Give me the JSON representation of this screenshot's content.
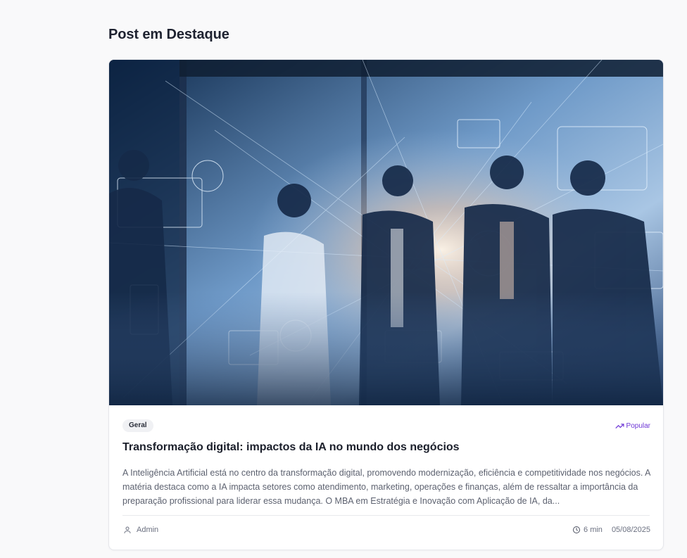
{
  "section": {
    "title": "Post em Destaque"
  },
  "post": {
    "image_alt": "Profissionais de negócios em reunião com interfaces digitais de IA",
    "category": "Geral",
    "badge": "Popular",
    "title": "Transformação digital: impactos da IA no mundo dos negócios",
    "excerpt": "A Inteligência Artificial está no centro da transformação digital, promovendo modernização, eficiência e competitividade nos negócios. A matéria destaca como a IA impacta setores como atendimento, marketing, operações e finanças, além de ressaltar a importância da preparação profissional para liderar essa mudança. O MBA em Estratégia e Inovação com Aplicação de IA, da...",
    "author": "Admin",
    "read_time": "6 min",
    "date": "05/08/2025",
    "icons": {
      "badge": "trending-up-icon",
      "author": "user-icon",
      "read_time": "clock-icon"
    }
  },
  "colors": {
    "accent": "#6d36d6",
    "title": "#1b1f2b",
    "text": "#5d6270",
    "muted": "#6b7080",
    "tag_bg": "#f0f1f4",
    "page_bg": "#f9f9fa"
  }
}
